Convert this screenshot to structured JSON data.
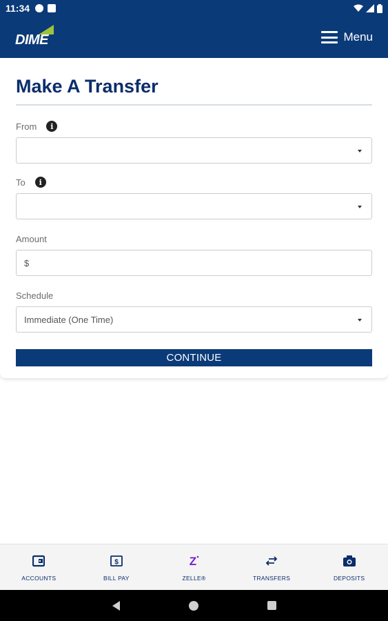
{
  "status_bar": {
    "time": "11:34"
  },
  "header": {
    "logo_text": "DIME",
    "menu_label": "Menu"
  },
  "form": {
    "title": "Make A Transfer",
    "from_label": "From",
    "from_value": "",
    "to_label": "To",
    "to_value": "",
    "amount_label": "Amount",
    "amount_value": "$",
    "schedule_label": "Schedule",
    "schedule_value": "Immediate (One Time)",
    "continue_label": "CONTINUE",
    "info_glyph": "i"
  },
  "bottom_nav": {
    "items": [
      {
        "label": "ACCOUNTS",
        "icon": "wallet-icon"
      },
      {
        "label": "BILL PAY",
        "icon": "bill-icon"
      },
      {
        "label": "ZELLE®",
        "icon": "zelle-icon"
      },
      {
        "label": "TRANSFERS",
        "icon": "transfer-arrows-icon"
      },
      {
        "label": "DEPOSITS",
        "icon": "camera-icon"
      }
    ]
  },
  "colors": {
    "brand_navy": "#0b3a78",
    "title_navy": "#0b2d6b",
    "logo_green": "#9dc33b",
    "zelle_purple": "#7a1fd1"
  }
}
